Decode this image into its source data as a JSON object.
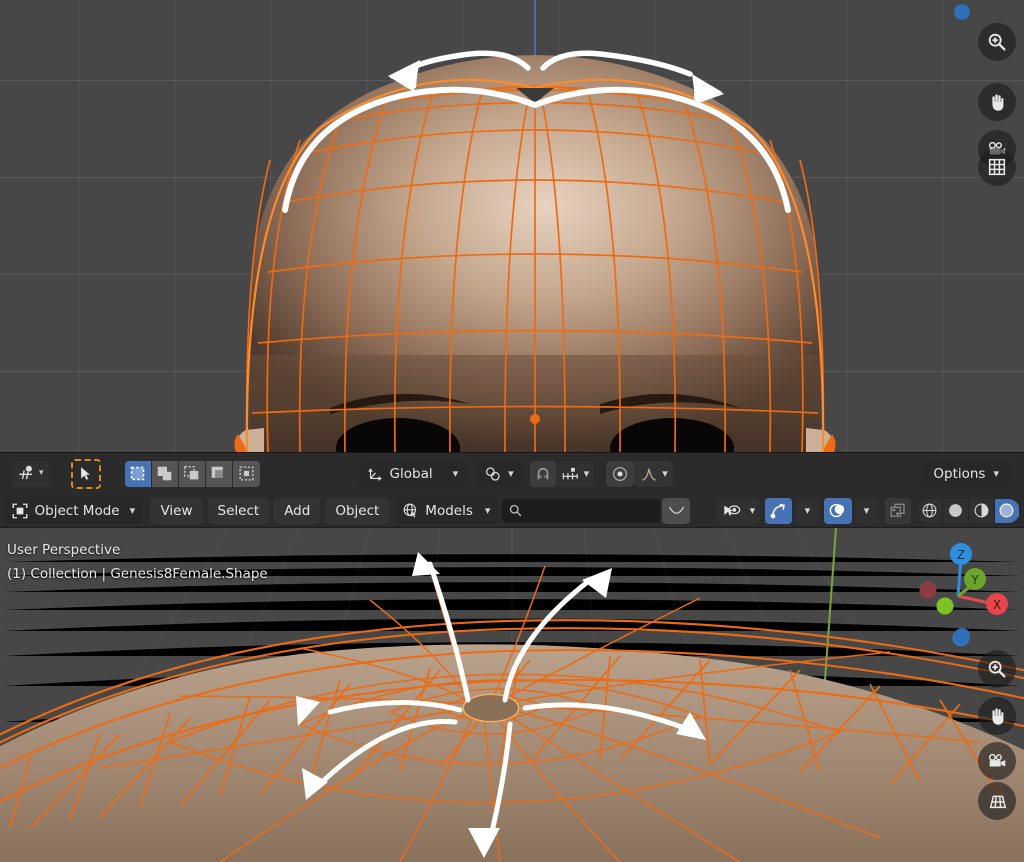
{
  "app": {
    "name": "Blender",
    "editor": "3D Viewport"
  },
  "tool_header": {
    "transform_pivot_icon": "pivot-point-icon",
    "cursor_tool_icon": "select-box-tool-icon",
    "select_modes": [
      {
        "name": "set-select-mode",
        "icon": "select-set-icon",
        "active": true
      },
      {
        "name": "extend-select-mode",
        "icon": "select-extend-icon",
        "active": false
      },
      {
        "name": "subtract-select-mode",
        "icon": "select-subtract-icon",
        "active": false
      },
      {
        "name": "invert-select-mode",
        "icon": "select-invert-icon",
        "active": false
      },
      {
        "name": "intersect-select-mode",
        "icon": "select-intersect-icon",
        "active": false
      }
    ],
    "orientation_label": "Global",
    "orientation_icon": "transform-orientation-icon",
    "pivot_icon": "pivot-median-point-icon",
    "snap_magnet_icon": "snap-magnet-icon",
    "snap_to_icon": "snap-increment-icon",
    "proportional_icon": "proportional-editing-icon",
    "falloff_icon": "proportional-falloff-smooth-icon",
    "options_label": "Options"
  },
  "main_header": {
    "mode_icon": "object-mode-icon",
    "mode_label": "Object Mode",
    "menus": [
      "View",
      "Select",
      "Add",
      "Object"
    ],
    "collection_icon": "scene-collection-icon",
    "collection_label": "Models",
    "search_icon": "search-icon",
    "search_value": "",
    "search_placeholder": "",
    "filter_icon": "filter-falloff-icon",
    "visibility_icon": "object-visibility-icon",
    "gizmo_icon": "gizmo-icon",
    "gizmo_active": true,
    "overlays_icon": "overlays-icon",
    "overlays_active": true,
    "xray_icon": "xray-toggle-icon",
    "xray_active": false,
    "shading_modes": [
      {
        "name": "shading-wireframe",
        "icon": "wireframe-sphere-icon",
        "active": false
      },
      {
        "name": "shading-solid",
        "icon": "solid-sphere-icon",
        "active": false
      },
      {
        "name": "shading-material",
        "icon": "material-preview-sphere-icon",
        "active": false
      },
      {
        "name": "shading-rendered",
        "icon": "rendered-sphere-icon",
        "active": true
      }
    ]
  },
  "viewport_overlay": {
    "perspective": "User Perspective",
    "collection_object": "(1) Collection | Genesis8Female.Shape"
  },
  "axis_gizmo": {
    "axes": [
      {
        "label": "Z",
        "color": "#2e8fdd"
      },
      {
        "label": "Y",
        "color": "#6ba42a"
      },
      {
        "label": "X",
        "color": "#e8464c"
      }
    ],
    "negative_colors": {
      "x": "#8e3b42",
      "y": "#7cc424",
      "z": "#2d7cc4"
    }
  },
  "nav_buttons_top": [
    {
      "name": "zoom-nav-icon",
      "icon": "magnifier-plus-icon"
    },
    {
      "name": "pan-nav-icon",
      "icon": "hand-icon"
    },
    {
      "name": "camera-nav-icon",
      "icon": "camera-icon"
    },
    {
      "name": "ortho-persp-nav-icon",
      "icon": "grid-icon"
    }
  ],
  "nav_buttons_bottom": [
    {
      "name": "zoom-nav-icon",
      "icon": "magnifier-plus-icon"
    },
    {
      "name": "pan-nav-icon",
      "icon": "hand-icon"
    },
    {
      "name": "camera-nav-icon",
      "icon": "camera-icon"
    },
    {
      "name": "ortho-persp-nav-icon",
      "icon": "grid-perspective-icon"
    }
  ],
  "colors": {
    "viewport_bg": "#474747",
    "header_bg": "#2b2b2b",
    "mesh_selected": "#ec6b15",
    "accent_blue": "#4772b3",
    "annotation_white": "#ffffff",
    "skin": "#b49983"
  },
  "annotations": {
    "top_viewport_arrows": "two curved white arrows sweeping outward left and right across the scalp dome",
    "bottom_viewport_arrows": "six curved white arrows radiating outward from the scalp pole vertex"
  }
}
